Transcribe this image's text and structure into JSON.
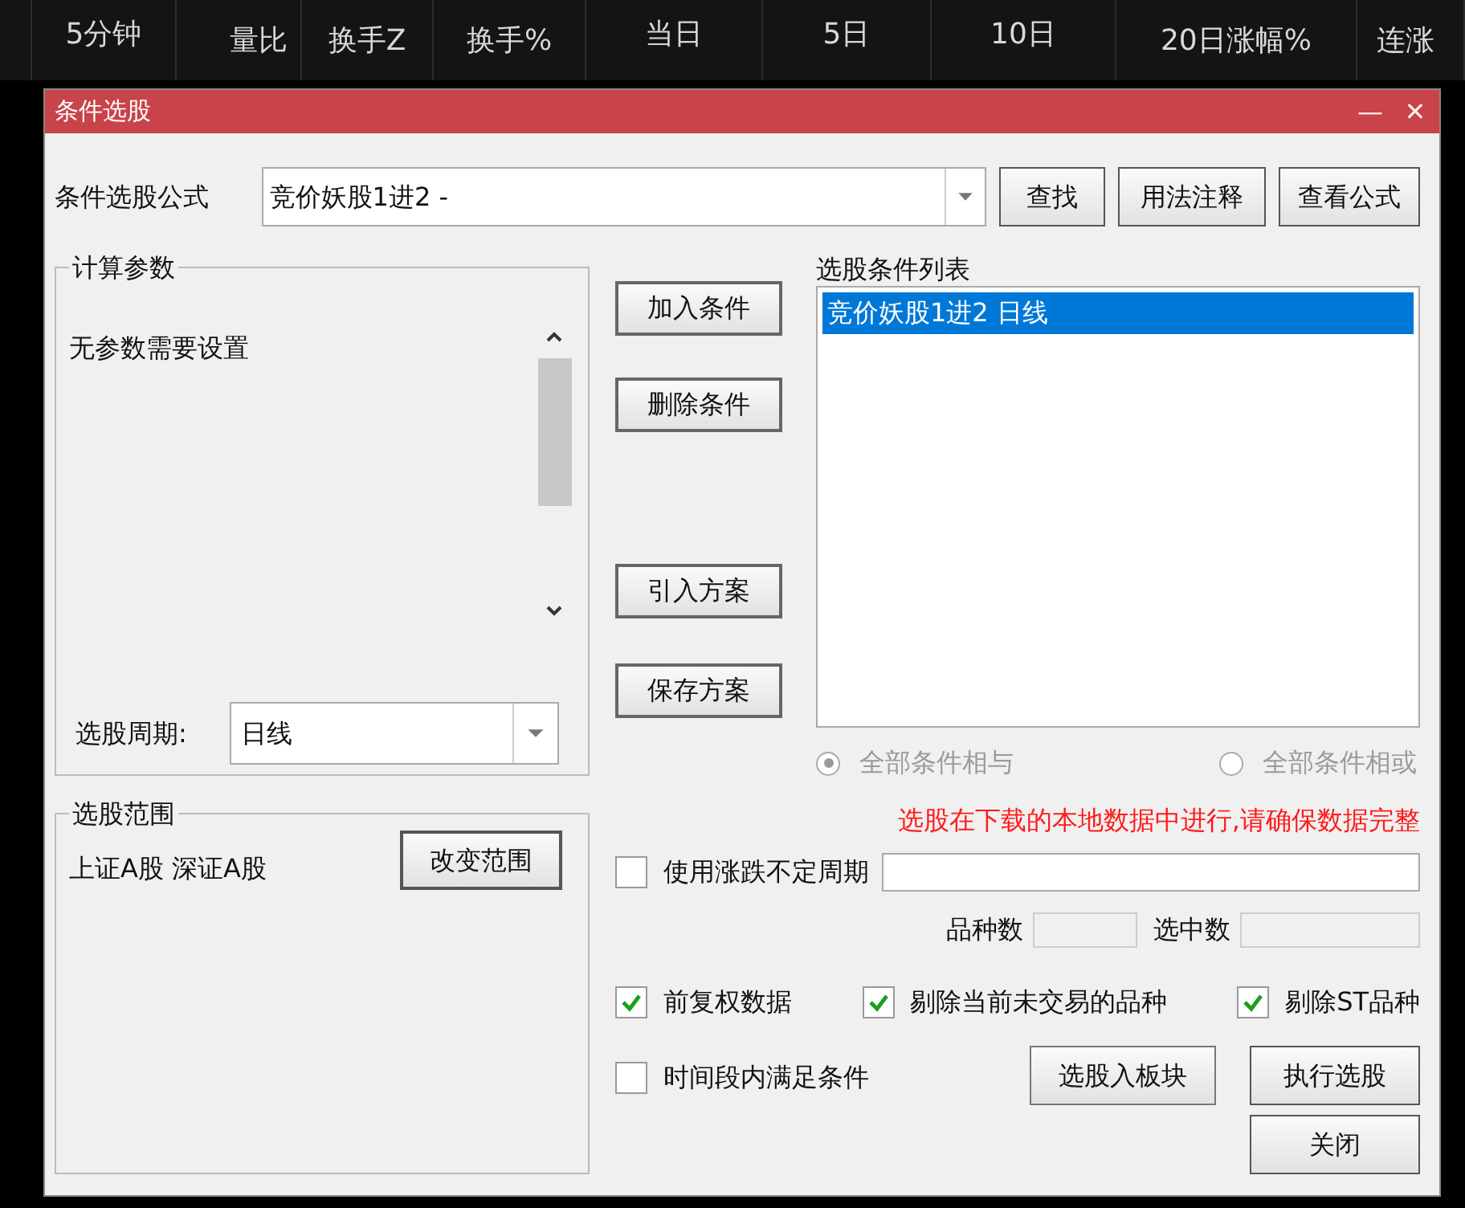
{
  "table_header": [
    "5分钟",
    "量比",
    "换手Z",
    "换手%",
    "当日",
    "5日",
    "10日",
    "20日涨幅%",
    "连涨"
  ],
  "window": {
    "title": "条件选股",
    "controls": [
      "—",
      "✕"
    ]
  },
  "formula": {
    "label": "条件选股公式",
    "value": "竞价妖股1进2 -",
    "buttons": [
      "查找",
      "用法注释",
      "查看公式"
    ]
  },
  "params": {
    "title": "计算参数",
    "message": "无参数需要设置",
    "period_label": "选股周期:",
    "period_value": "日线"
  },
  "scope": {
    "title": "选股范围",
    "value": "上证A股 深证A股",
    "button": "改变范围"
  },
  "actions": [
    "加入条件",
    "删除条件",
    "引入方案",
    "保存方案"
  ],
  "condition_list": {
    "title": "选股条件列表",
    "items": [
      {
        "label": "竞价妖股1进2  日线",
        "selected": true
      }
    ]
  },
  "logic": [
    {
      "label": "全部条件相与",
      "selected": true,
      "disabled": true
    },
    {
      "label": "全部条件相或",
      "selected": false,
      "disabled": true
    }
  ],
  "warning": "选股在下载的本地数据中进行,请确保数据完整",
  "variable_period": {
    "label": "使用涨跌不定周期",
    "checked": false
  },
  "counts": [
    {
      "label": "品种数"
    },
    {
      "label": "选中数"
    }
  ],
  "options": [
    {
      "label": "前复权数据",
      "checked": true
    },
    {
      "label": "剔除当前未交易的品种",
      "checked": true
    },
    {
      "label": "剔除ST品种",
      "checked": true
    }
  ],
  "time_range": {
    "label": "时间段内满足条件",
    "checked": false
  },
  "bottom_buttons": [
    "选股入板块",
    "执行选股",
    "关闭"
  ]
}
